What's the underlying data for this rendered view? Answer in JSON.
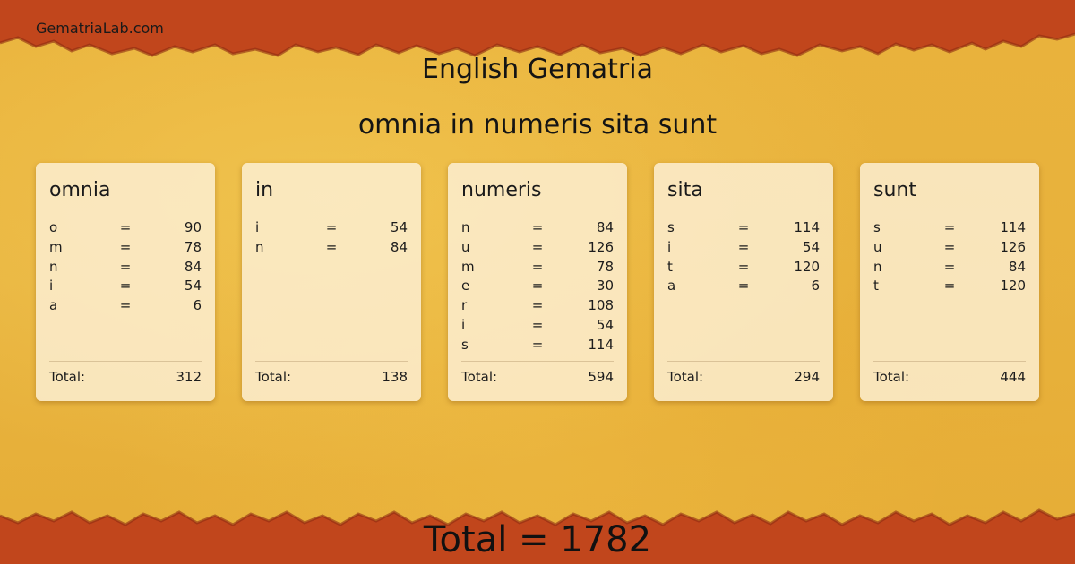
{
  "site_name": "GematriaLab.com",
  "title": "English Gematria",
  "phrase": "omnia in numeris sita sunt",
  "total_label": "Total:",
  "grand_total": "Total = 1782",
  "colors": {
    "band": "#c0451b",
    "background": "#e5b13a",
    "card": "#fcf0d7"
  },
  "words": [
    {
      "word": "omnia",
      "total": "312",
      "letters": [
        {
          "l": "o",
          "eq": "=",
          "v": "90"
        },
        {
          "l": "m",
          "eq": "=",
          "v": "78"
        },
        {
          "l": "n",
          "eq": "=",
          "v": "84"
        },
        {
          "l": "i",
          "eq": "=",
          "v": "54"
        },
        {
          "l": "a",
          "eq": "=",
          "v": "6"
        }
      ]
    },
    {
      "word": "in",
      "total": "138",
      "letters": [
        {
          "l": "i",
          "eq": "=",
          "v": "54"
        },
        {
          "l": "n",
          "eq": "=",
          "v": "84"
        }
      ]
    },
    {
      "word": "numeris",
      "total": "594",
      "letters": [
        {
          "l": "n",
          "eq": "=",
          "v": "84"
        },
        {
          "l": "u",
          "eq": "=",
          "v": "126"
        },
        {
          "l": "m",
          "eq": "=",
          "v": "78"
        },
        {
          "l": "e",
          "eq": "=",
          "v": "30"
        },
        {
          "l": "r",
          "eq": "=",
          "v": "108"
        },
        {
          "l": "i",
          "eq": "=",
          "v": "54"
        },
        {
          "l": "s",
          "eq": "=",
          "v": "114"
        }
      ]
    },
    {
      "word": "sita",
      "total": "294",
      "letters": [
        {
          "l": "s",
          "eq": "=",
          "v": "114"
        },
        {
          "l": "i",
          "eq": "=",
          "v": "54"
        },
        {
          "l": "t",
          "eq": "=",
          "v": "120"
        },
        {
          "l": "a",
          "eq": "=",
          "v": "6"
        }
      ]
    },
    {
      "word": "sunt",
      "total": "444",
      "letters": [
        {
          "l": "s",
          "eq": "=",
          "v": "114"
        },
        {
          "l": "u",
          "eq": "=",
          "v": "126"
        },
        {
          "l": "n",
          "eq": "=",
          "v": "84"
        },
        {
          "l": "t",
          "eq": "=",
          "v": "120"
        }
      ]
    }
  ]
}
